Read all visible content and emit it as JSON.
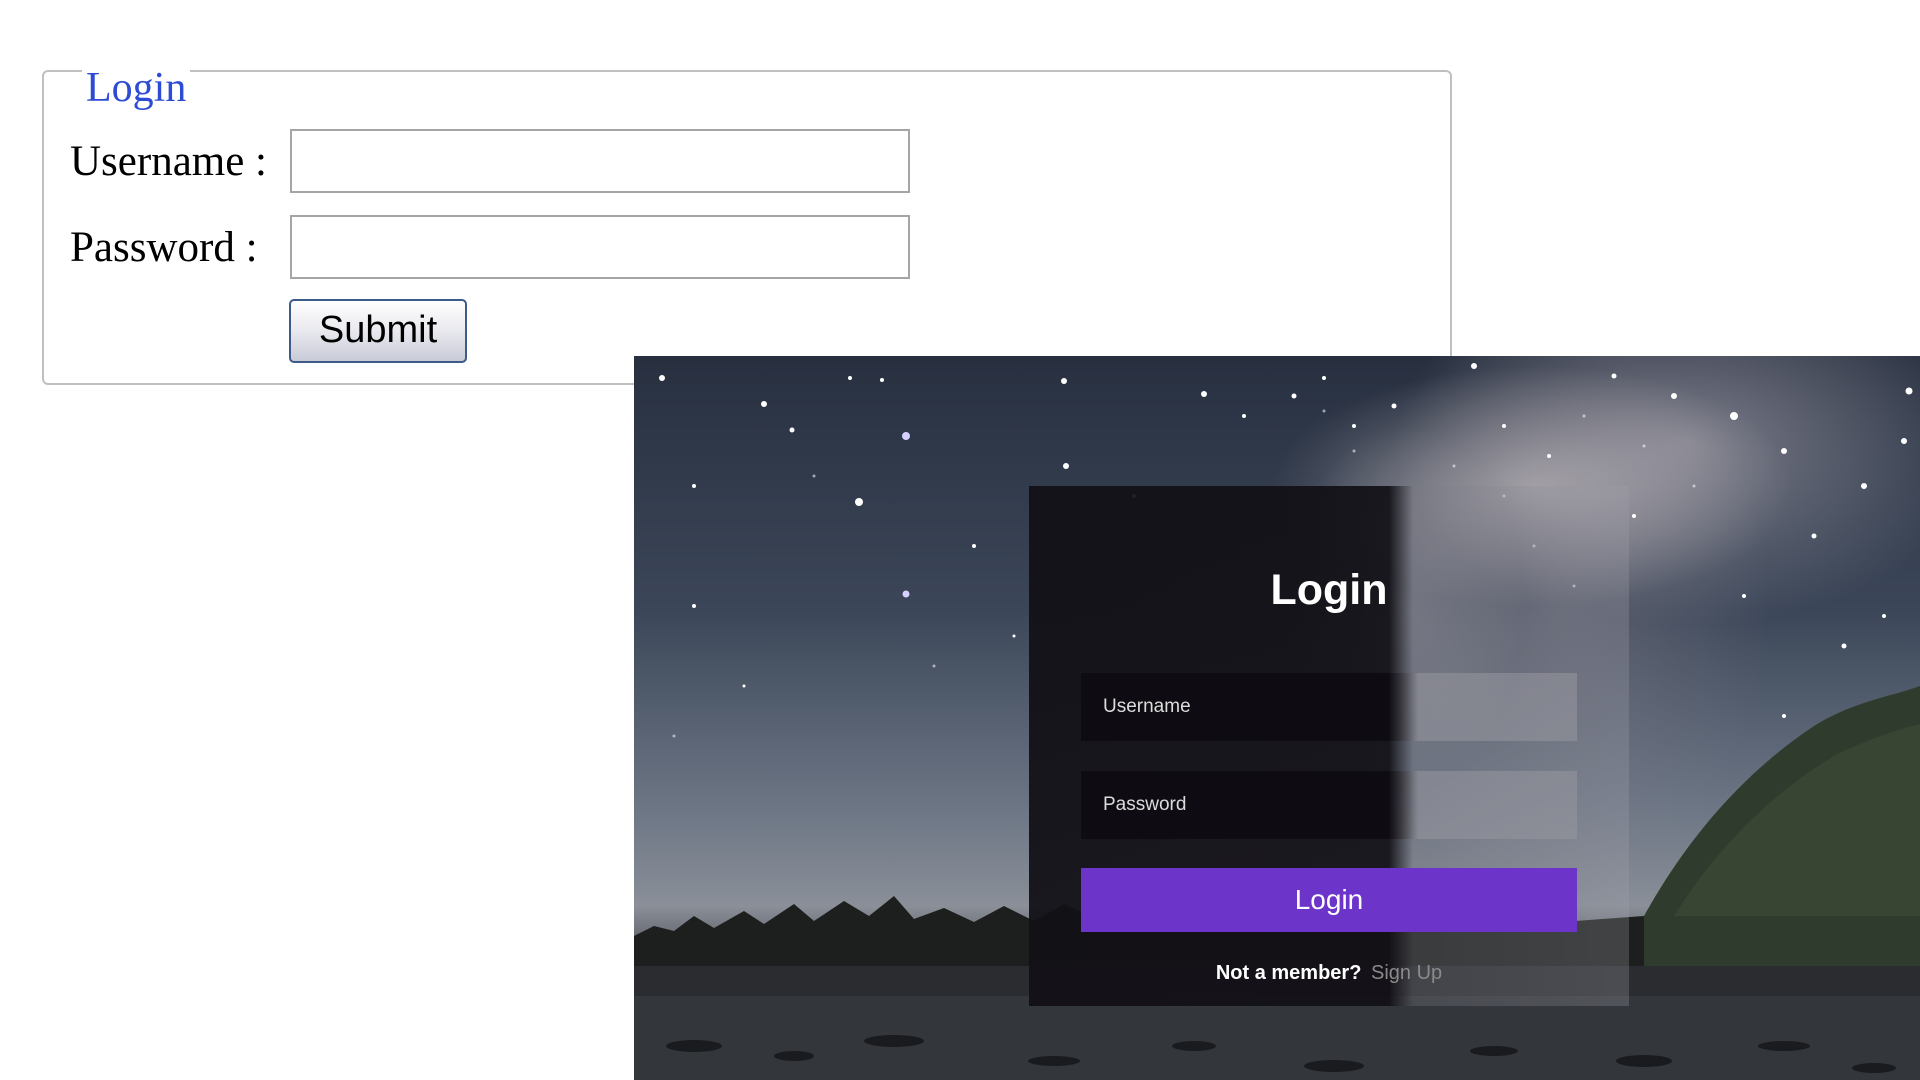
{
  "plain_form": {
    "legend": "Login",
    "username_label": "Username :",
    "username_value": "",
    "password_label": "Password :",
    "password_value": "",
    "submit_label": "Submit"
  },
  "styled_form": {
    "title": "Login",
    "username_placeholder": "Username",
    "password_placeholder": "Password",
    "login_button": "Login",
    "footer_question": "Not a member?",
    "signup_link": "Sign Up",
    "accent_color": "#6c34c8"
  }
}
